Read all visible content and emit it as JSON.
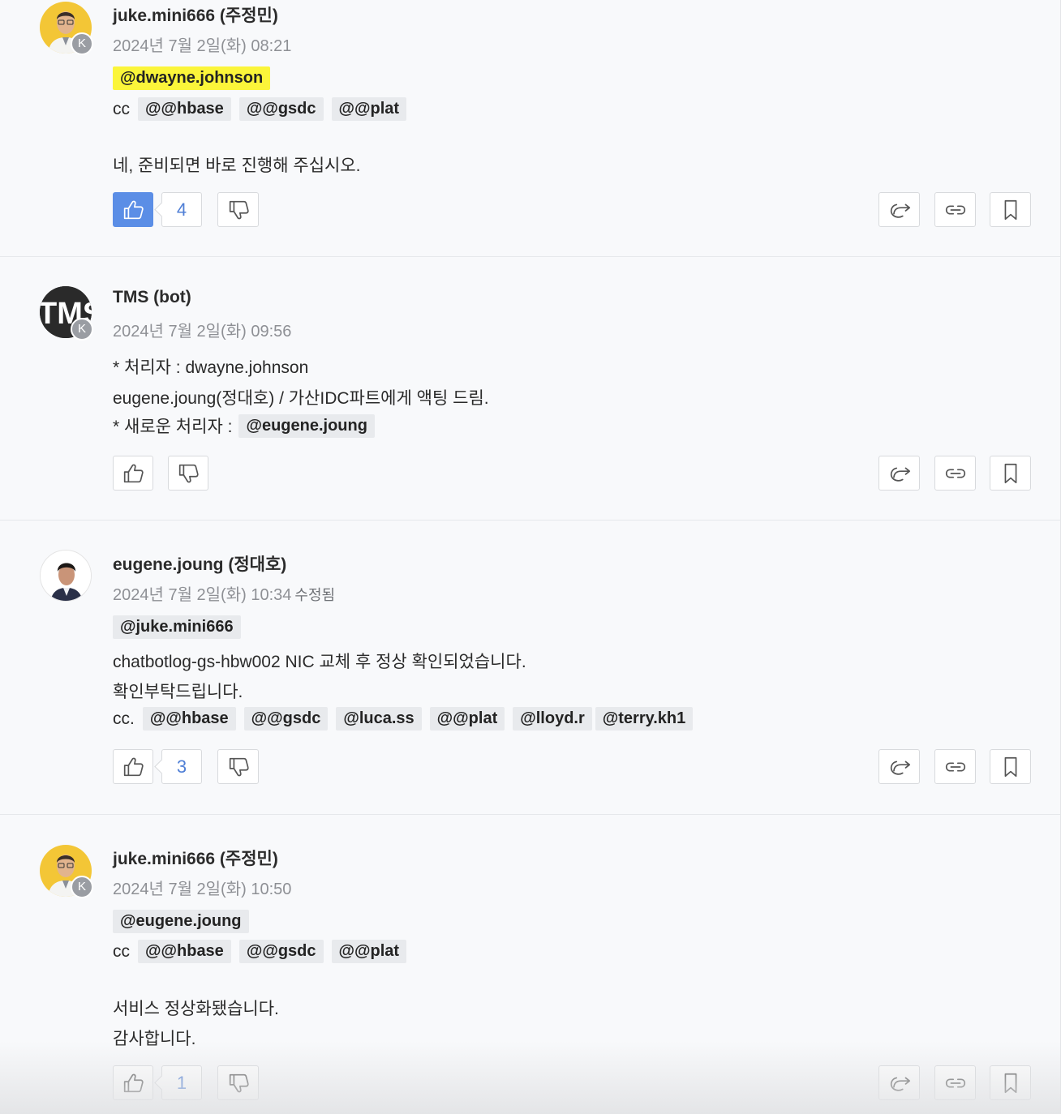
{
  "posts": [
    {
      "author": "juke.mini666 (주정민)",
      "timestamp": "2024년 7월 2일(화) 08:21",
      "edited": "",
      "lines": {
        "mention_primary": "@dwayne.johnson",
        "cc_label": "cc",
        "cc_mentions": [
          "@@hbase",
          "@@gsdc",
          "@@plat"
        ],
        "text1": "네, 준비되면 바로 진행해 주십시오."
      },
      "reactions": {
        "likes": "4",
        "liked": true
      }
    },
    {
      "author": "TMS (bot)",
      "timestamp": "2024년 7월 2일(화) 09:56",
      "edited": "",
      "avatar_text": "TMS",
      "lines": {
        "text1": "* 처리자 : dwayne.johnson",
        "text2": "eugene.joung(정대호) / 가산IDC파트에게 액팅 드림.",
        "text3": "* 새로운 처리자 :",
        "mention": "@eugene.joung"
      },
      "reactions": {
        "likes": "",
        "liked": false
      }
    },
    {
      "author": "eugene.joung (정대호)",
      "timestamp": "2024년 7월 2일(화) 10:34",
      "edited": "수정됨",
      "lines": {
        "mention_primary": "@juke.mini666",
        "text1": "chatbotlog-gs-hbw002 NIC 교체 후 정상 확인되었습니다.",
        "text2": "확인부탁드립니다.",
        "cc_label": "cc.",
        "cc_mentions": [
          "@@hbase",
          "@@gsdc",
          "@luca.ss",
          "@@plat",
          "@lloyd.r",
          "@terry.kh1"
        ]
      },
      "reactions": {
        "likes": "3",
        "liked": false
      }
    },
    {
      "author": "juke.mini666 (주정민)",
      "timestamp": "2024년 7월 2일(화) 10:50",
      "edited": "",
      "lines": {
        "mention_primary": "@eugene.joung",
        "cc_label": "cc",
        "cc_mentions": [
          "@@hbase",
          "@@gsdc",
          "@@plat"
        ],
        "text1": "서비스 정상화됐습니다.",
        "text2": "감사합니다."
      },
      "reactions": {
        "likes": "1",
        "liked": false
      }
    }
  ],
  "avatar_badge": "K",
  "icons": [
    "thumbs-up-icon",
    "thumbs-down-icon",
    "share-icon",
    "link-icon",
    "bookmark-icon"
  ],
  "colors": {
    "accent": "#5b8ee6",
    "mention_bg": "#e8eaed",
    "mention_highlight": "#fbf53a",
    "count_text": "#4f7fd6"
  }
}
